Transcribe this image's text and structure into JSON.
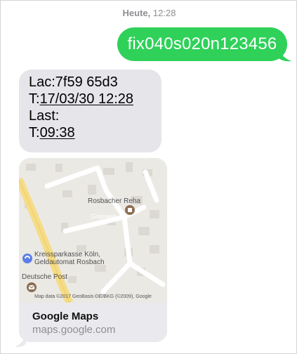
{
  "timestamp": {
    "day": "Heute,",
    "time": "12:28"
  },
  "outgoing_message": {
    "text": "fix040s020n123456"
  },
  "incoming_message": {
    "line1": "Lac:7f59 65d3",
    "line2_prefix": "T:",
    "line2_link": "17/03/30 12:28",
    "line3": "Last:",
    "line4_prefix": "T:",
    "line4_link": "09:38"
  },
  "map_card": {
    "poi_rehab": "Rosbacher Reha",
    "street": "Grasweg",
    "poi_bank_line1": "Kreissparkasse Köln,",
    "poi_bank_line2": "Geldautomat Rosbach",
    "poi_post": "Deutsche Post",
    "attribution": "Map data ©2017 GeoBasis-DE/BKG (©2009), Google",
    "title": "Google Maps",
    "url": "maps.google.com"
  },
  "colors": {
    "outgoing_bubble": "#2fd159",
    "incoming_bubble": "#e5e5ea",
    "timestamp_text": "#8e8e93",
    "main_road": "#f6dc86"
  },
  "icons": {
    "rehab_marker": "medical-marker-icon",
    "bank_marker": "bank-marker-icon",
    "post_marker": "mail-marker-icon"
  }
}
